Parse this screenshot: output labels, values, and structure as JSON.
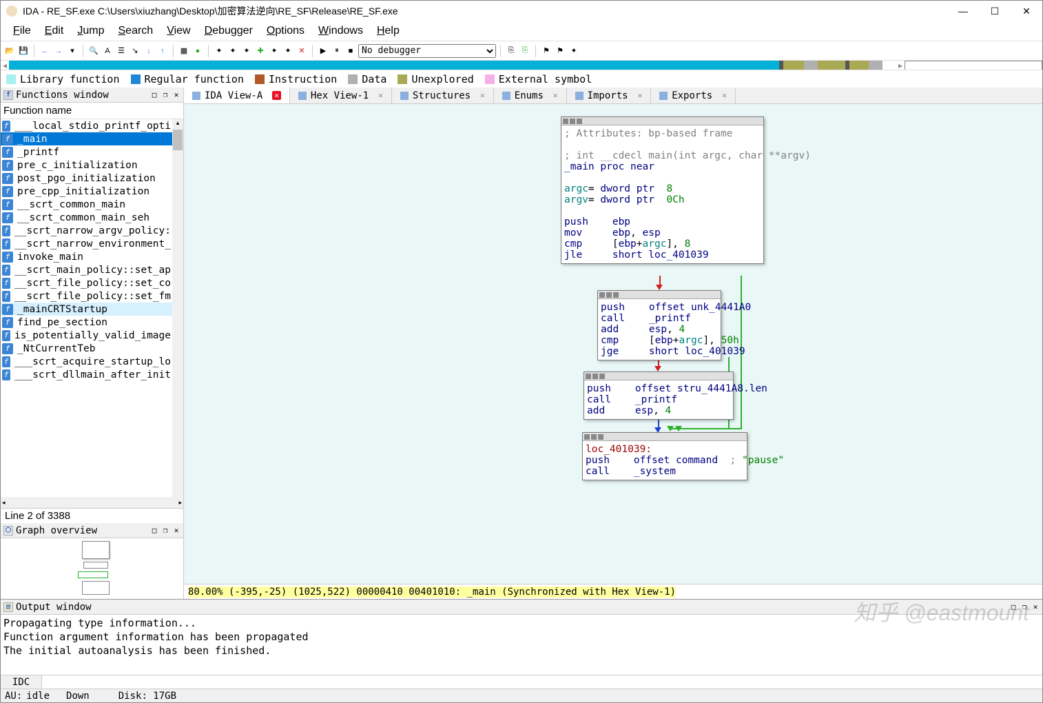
{
  "title": "IDA - RE_SF.exe C:\\Users\\xiuzhang\\Desktop\\加密算法逆向\\RE_SF\\Release\\RE_SF.exe",
  "menus": [
    "File",
    "Edit",
    "Jump",
    "Search",
    "View",
    "Debugger",
    "Options",
    "Windows",
    "Help"
  ],
  "debugger": {
    "selected": "No debugger"
  },
  "legend": [
    {
      "color": "#a6f0ef",
      "label": "Library function"
    },
    {
      "color": "#1f87d6",
      "label": "Regular function"
    },
    {
      "color": "#b05a2a",
      "label": "Instruction"
    },
    {
      "color": "#b0b0b0",
      "label": "Data"
    },
    {
      "color": "#aaaa55",
      "label": "Unexplored"
    },
    {
      "color": "#f5b0e8",
      "label": "External symbol"
    }
  ],
  "functions_panel": {
    "title": "Functions window",
    "header": "Function name",
    "line_info": "Line 2 of 3388"
  },
  "functions": [
    "___local_stdio_printf_opti",
    "_main",
    "_printf",
    "pre_c_initialization",
    "post_pgo_initialization",
    "pre_cpp_initialization",
    "__scrt_common_main",
    "__scrt_common_main_seh",
    "__scrt_narrow_argv_policy:",
    "__scrt_narrow_environment_",
    "invoke_main",
    "__scrt_main_policy::set_ap",
    "__scrt_file_policy::set_co",
    "__scrt_file_policy::set_fm",
    "_mainCRTStartup",
    "find_pe_section",
    "is_potentially_valid_image",
    "_NtCurrentTeb",
    "___scrt_acquire_startup_lo",
    "___scrt_dllmain_after_init"
  ],
  "selected_fn_index": 1,
  "highlighted_fn_index": 14,
  "graph_overview": {
    "title": "Graph overview"
  },
  "tabs": [
    "IDA View-A",
    "Hex View-1",
    "Structures",
    "Enums",
    "Imports",
    "Exports"
  ],
  "active_tab_index": 0,
  "graph_status": "80.00% (-395,-25) (1025,522) 00000410 00401010: _main (Synchronized with Hex View-1)",
  "output_panel": {
    "title": "Output window"
  },
  "output_lines": [
    "Propagating type information...",
    "Function argument information has been propagated",
    "The initial autoanalysis has been finished."
  ],
  "idc": {
    "label": "IDC"
  },
  "status": {
    "au": "AU:",
    "state": "idle",
    "down": "Down",
    "disk": "Disk: 17GB"
  },
  "watermark": "知乎 @eastmount",
  "code_blocks": {
    "b1": {
      "attr_comment": "; Attributes: bp-based frame",
      "sig_comment": "; int __cdecl main(int argc, char **argv)",
      "header": "_main proc near",
      "line1": "argc= dword ptr  8",
      "line2": "argv= dword ptr  0Ch",
      "i1_op": "push",
      "i1_args": "ebp",
      "i2_op": "mov",
      "i2_args": "ebp, esp",
      "i3_op": "cmp",
      "i3_args": "[ebp+argc], 8",
      "i4_op": "jle",
      "i4_args": "short loc_401039"
    },
    "b2": {
      "i1": "push    offset unk_4441A0",
      "i2": "call    _printf",
      "i3": "add     esp, 4",
      "i4": "cmp     [ebp+argc], 50h",
      "i5": "jge     short loc_401039"
    },
    "b3": {
      "i1": "push    offset stru_4441A8.len",
      "i2": "call    _printf",
      "i3": "add     esp, 4"
    },
    "b4": {
      "label": "loc_401039:",
      "i1": "push    offset command  ; \"pause\"",
      "i2": "call    _system"
    }
  }
}
